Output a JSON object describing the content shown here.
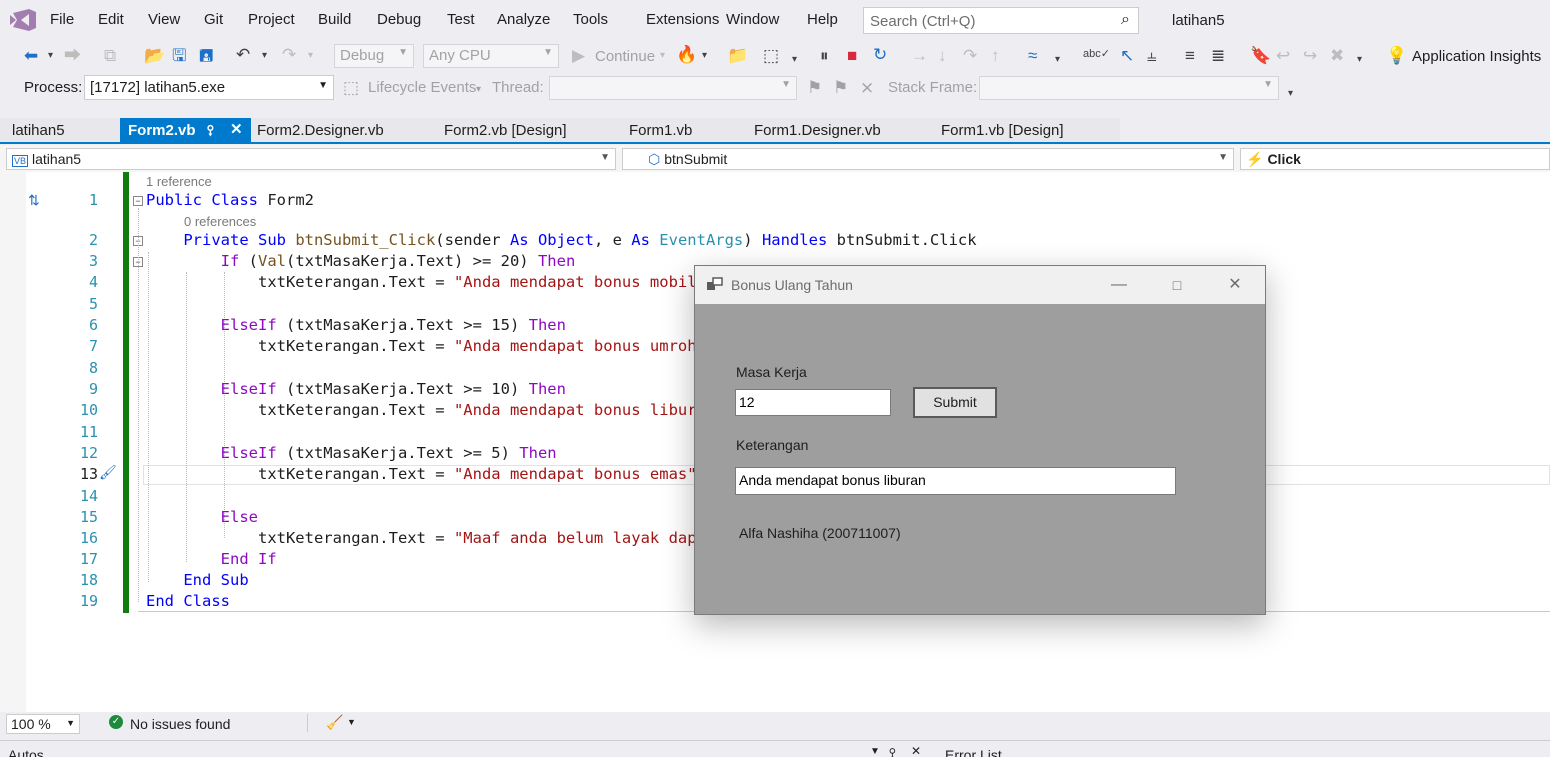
{
  "menu": {
    "items": [
      "File",
      "Edit",
      "View",
      "Git",
      "Project",
      "Build",
      "Debug",
      "Test",
      "Analyze",
      "Tools",
      "Extensions",
      "Window",
      "Help"
    ],
    "search_placeholder": "Search (Ctrl+Q)",
    "solution_name": "latihan5"
  },
  "toolbar": {
    "config": "Debug",
    "platform": "Any CPU",
    "continue_label": "Continue",
    "app_insights": "Application Insights",
    "process_label": "Process:",
    "process_value": "[17172] latihan5.exe",
    "lifecycle_label": "Lifecycle Events",
    "thread_label": "Thread:",
    "stack_frame_label": "Stack Frame:"
  },
  "tabs": [
    {
      "label": "latihan5"
    },
    {
      "label": "Form2.vb",
      "active": true
    },
    {
      "label": "Form2.Designer.vb"
    },
    {
      "label": "Form2.vb [Design]"
    },
    {
      "label": "Form1.vb"
    },
    {
      "label": "Form1.Designer.vb"
    },
    {
      "label": "Form1.vb [Design]"
    }
  ],
  "navbar": {
    "project": "latihan5",
    "object": "btnSubmit",
    "event": "Click"
  },
  "editor": {
    "codelens": [
      "1 reference",
      "0 references"
    ],
    "line_numbers": [
      "1",
      "2",
      "3",
      "4",
      "5",
      "6",
      "7",
      "8",
      "9",
      "10",
      "11",
      "12",
      "13",
      "14",
      "15",
      "16",
      "17",
      "18",
      "19"
    ],
    "lines": [
      {
        "n": 1,
        "tokens": [
          [
            "kw",
            "Public "
          ],
          [
            "kw",
            "Class "
          ],
          [
            "",
            "Form2"
          ]
        ]
      },
      {
        "n": 2,
        "tokens": [
          [
            "",
            "    "
          ],
          [
            "kw",
            "Private "
          ],
          [
            "kw",
            "Sub "
          ],
          [
            "fn",
            "btnSubmit_Click"
          ],
          [
            "",
            "(sender "
          ],
          [
            "kw",
            "As "
          ],
          [
            "kw",
            "Object"
          ],
          [
            "",
            ", e "
          ],
          [
            "kw",
            "As "
          ],
          [
            "ty",
            "EventArgs"
          ],
          [
            "",
            ") "
          ],
          [
            "kw",
            "Handles "
          ],
          [
            "",
            "btnSubmit.Click"
          ]
        ]
      },
      {
        "n": 3,
        "tokens": [
          [
            "",
            "        "
          ],
          [
            "kwp",
            "If "
          ],
          [
            "",
            "("
          ],
          [
            "fn",
            "Val"
          ],
          [
            "",
            "(txtMasaKerja.Text) >= 20) "
          ],
          [
            "kwp",
            "Then"
          ]
        ]
      },
      {
        "n": 4,
        "tokens": [
          [
            "",
            "            txtKeterangan.Text = "
          ],
          [
            "str",
            "\"Anda mendapat bonus mobil\""
          ]
        ]
      },
      {
        "n": 5,
        "tokens": []
      },
      {
        "n": 6,
        "tokens": [
          [
            "",
            "        "
          ],
          [
            "kwp",
            "ElseIf "
          ],
          [
            "",
            "(txtMasaKerja.Text >= 15) "
          ],
          [
            "kwp",
            "Then"
          ]
        ]
      },
      {
        "n": 7,
        "tokens": [
          [
            "",
            "            txtKeterangan.Text = "
          ],
          [
            "str",
            "\"Anda mendapat bonus umroh\""
          ]
        ]
      },
      {
        "n": 8,
        "tokens": []
      },
      {
        "n": 9,
        "tokens": [
          [
            "",
            "        "
          ],
          [
            "kwp",
            "ElseIf "
          ],
          [
            "",
            "(txtMasaKerja.Text >= 10) "
          ],
          [
            "kwp",
            "Then"
          ]
        ]
      },
      {
        "n": 10,
        "tokens": [
          [
            "",
            "            txtKeterangan.Text = "
          ],
          [
            "str",
            "\"Anda mendapat bonus liburan\""
          ]
        ]
      },
      {
        "n": 11,
        "tokens": []
      },
      {
        "n": 12,
        "tokens": [
          [
            "",
            "        "
          ],
          [
            "kwp",
            "ElseIf "
          ],
          [
            "",
            "(txtMasaKerja.Text >= 5) "
          ],
          [
            "kwp",
            "Then"
          ]
        ]
      },
      {
        "n": 13,
        "tokens": [
          [
            "",
            "            txtKeterangan.Text = "
          ],
          [
            "str",
            "\"Anda mendapat bonus emas\""
          ]
        ]
      },
      {
        "n": 14,
        "tokens": []
      },
      {
        "n": 15,
        "tokens": [
          [
            "",
            "        "
          ],
          [
            "kwp",
            "Else"
          ]
        ]
      },
      {
        "n": 16,
        "tokens": [
          [
            "",
            "            txtKeterangan.Text = "
          ],
          [
            "str",
            "\"Maaf anda belum layak dapat bonus\""
          ]
        ]
      },
      {
        "n": 17,
        "tokens": [
          [
            "",
            "        "
          ],
          [
            "kwp",
            "End If"
          ]
        ]
      },
      {
        "n": 18,
        "tokens": [
          [
            "",
            "    "
          ],
          [
            "kw",
            "End Sub"
          ]
        ]
      },
      {
        "n": 19,
        "tokens": [
          [
            "kw",
            "End Class"
          ]
        ]
      }
    ]
  },
  "statusbar": {
    "zoom": "100 %",
    "issues": "No issues found",
    "bottom_left": "Autos",
    "bottom_right": "Error List"
  },
  "dialog": {
    "title": "Bonus Ulang Tahun",
    "masa_kerja_label": "Masa Kerja",
    "masa_kerja_value": "12",
    "submit_label": "Submit",
    "keterangan_label": "Keterangan",
    "keterangan_value": "Anda mendapat bonus liburan",
    "author": "Alfa Nashiha (200711007)"
  }
}
